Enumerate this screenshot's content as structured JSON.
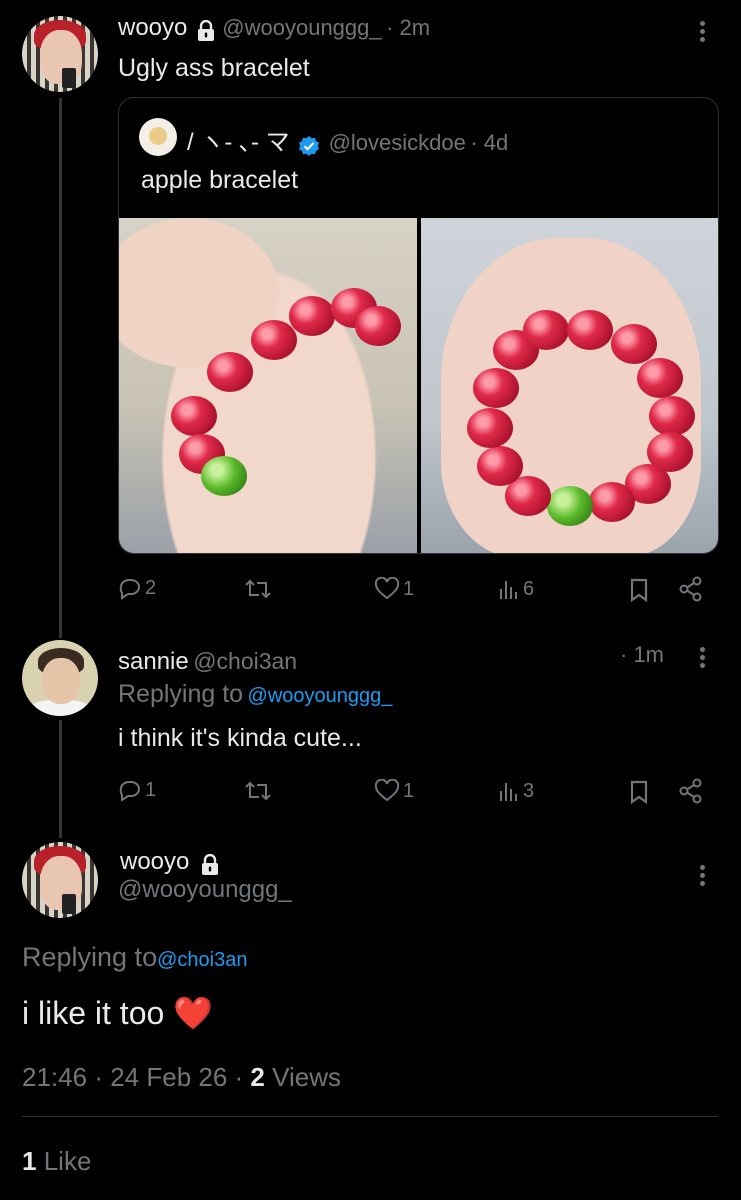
{
  "tweet1": {
    "name": "wooyo",
    "handle": "@wooyounggg_",
    "time": "· 2m",
    "text": "Ugly ass bracelet",
    "quote": {
      "name": "/ ヽ- ､- マ",
      "handle": "@lovesickdoe",
      "time": "· 4d",
      "text": "apple bracelet"
    },
    "actions": {
      "replies": "2",
      "likes": "1",
      "views": "6"
    }
  },
  "tweet2": {
    "name": "sannie",
    "handle": "@choi3an",
    "time": "· 1m",
    "replying_prefix": "Replying to",
    "replying_handle": "@wooyounggg_",
    "text": "i think it's kinda cute...",
    "actions": {
      "replies": "1",
      "likes": "1",
      "views": "3"
    }
  },
  "tweet3": {
    "name": "wooyo",
    "handle": "@wooyounggg_",
    "replying_prefix": "Replying to",
    "replying_handle": "@choi3an",
    "text": "i like it too",
    "emoji": "❤️",
    "time": "21:46",
    "date": "24 Feb 26",
    "views_count": "2",
    "views_label": "Views",
    "likes_count": "1",
    "likes_label": "Like"
  },
  "icons": {
    "reply": "reply-icon",
    "retweet": "retweet-icon",
    "like": "heart-icon",
    "views": "views-icon",
    "bookmark": "bookmark-icon",
    "share": "share-icon",
    "lock": "lock-icon",
    "verified": "verified-icon",
    "more": "more-icon"
  },
  "colors": {
    "background": "#000000",
    "text": "#e7e9ea",
    "muted": "#71767b",
    "accent": "#1d9bf0"
  }
}
